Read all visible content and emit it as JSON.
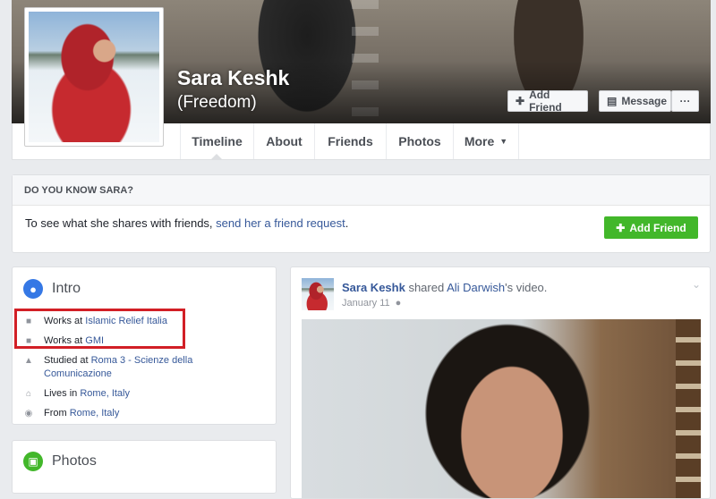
{
  "profile": {
    "name": "Sara Keshk",
    "alternate_name": "(Freedom)"
  },
  "cover_actions": {
    "add_friend": "Add Friend",
    "message": "Message",
    "more": "···"
  },
  "tabs": [
    {
      "label": "Timeline"
    },
    {
      "label": "About"
    },
    {
      "label": "Friends"
    },
    {
      "label": "Photos"
    },
    {
      "label": "More",
      "caret": "▼"
    }
  ],
  "know_box": {
    "heading": "DO YOU KNOW SARA?",
    "text": "To see what she shares with friends, ",
    "link": "send her a friend request",
    "text_end": ".",
    "button": "Add Friend"
  },
  "intro": {
    "title": "Intro",
    "items": [
      {
        "prefix": "Works at ",
        "link": "Islamic Relief Italia",
        "icon": "briefcase-icon"
      },
      {
        "prefix": "Works at ",
        "link": "GMI",
        "icon": "briefcase-icon"
      },
      {
        "prefix": "Studied at ",
        "link": "Roma 3 - Scienze della Comunicazione",
        "icon": "graduation-cap-icon"
      },
      {
        "prefix": "Lives in ",
        "link": "Rome, Italy",
        "icon": "home-icon"
      },
      {
        "prefix": "From ",
        "link": "Rome, Italy",
        "icon": "location-pin-icon"
      }
    ]
  },
  "photos": {
    "title": "Photos"
  },
  "post": {
    "author": "Sara Keshk",
    "action": " shared ",
    "target": "Ali Darwish",
    "suffix": "'s video.",
    "date": "January 11",
    "privacy_icon": "globe-icon"
  },
  "colors": {
    "accent_blue": "#365899",
    "green_button": "#42b72a",
    "highlight_red": "#d21f26",
    "background": "#e9ebee"
  }
}
